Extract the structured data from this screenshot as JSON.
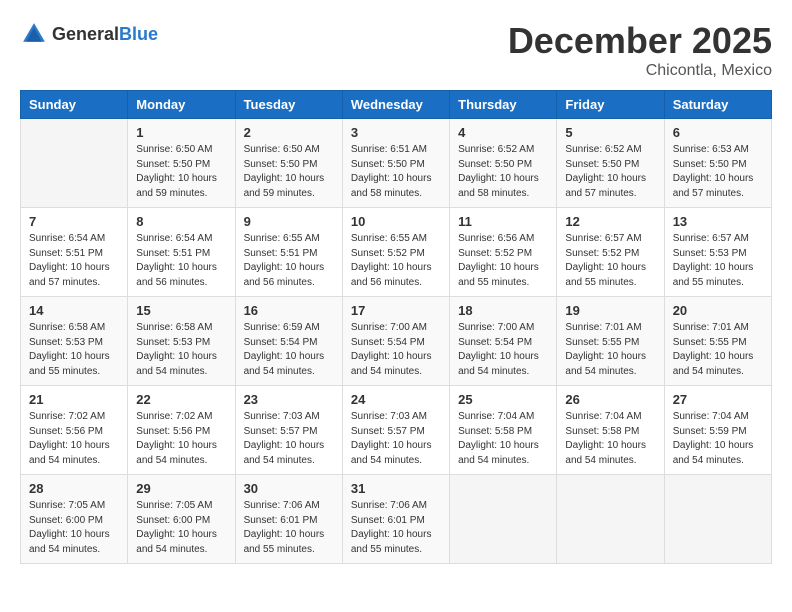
{
  "header": {
    "logo_general": "General",
    "logo_blue": "Blue",
    "month_year": "December 2025",
    "location": "Chicontla, Mexico"
  },
  "weekdays": [
    "Sunday",
    "Monday",
    "Tuesday",
    "Wednesday",
    "Thursday",
    "Friday",
    "Saturday"
  ],
  "weeks": [
    [
      {
        "day": "",
        "info": ""
      },
      {
        "day": "1",
        "info": "Sunrise: 6:50 AM\nSunset: 5:50 PM\nDaylight: 10 hours\nand 59 minutes."
      },
      {
        "day": "2",
        "info": "Sunrise: 6:50 AM\nSunset: 5:50 PM\nDaylight: 10 hours\nand 59 minutes."
      },
      {
        "day": "3",
        "info": "Sunrise: 6:51 AM\nSunset: 5:50 PM\nDaylight: 10 hours\nand 58 minutes."
      },
      {
        "day": "4",
        "info": "Sunrise: 6:52 AM\nSunset: 5:50 PM\nDaylight: 10 hours\nand 58 minutes."
      },
      {
        "day": "5",
        "info": "Sunrise: 6:52 AM\nSunset: 5:50 PM\nDaylight: 10 hours\nand 57 minutes."
      },
      {
        "day": "6",
        "info": "Sunrise: 6:53 AM\nSunset: 5:50 PM\nDaylight: 10 hours\nand 57 minutes."
      }
    ],
    [
      {
        "day": "7",
        "info": "Sunrise: 6:54 AM\nSunset: 5:51 PM\nDaylight: 10 hours\nand 57 minutes."
      },
      {
        "day": "8",
        "info": "Sunrise: 6:54 AM\nSunset: 5:51 PM\nDaylight: 10 hours\nand 56 minutes."
      },
      {
        "day": "9",
        "info": "Sunrise: 6:55 AM\nSunset: 5:51 PM\nDaylight: 10 hours\nand 56 minutes."
      },
      {
        "day": "10",
        "info": "Sunrise: 6:55 AM\nSunset: 5:52 PM\nDaylight: 10 hours\nand 56 minutes."
      },
      {
        "day": "11",
        "info": "Sunrise: 6:56 AM\nSunset: 5:52 PM\nDaylight: 10 hours\nand 55 minutes."
      },
      {
        "day": "12",
        "info": "Sunrise: 6:57 AM\nSunset: 5:52 PM\nDaylight: 10 hours\nand 55 minutes."
      },
      {
        "day": "13",
        "info": "Sunrise: 6:57 AM\nSunset: 5:53 PM\nDaylight: 10 hours\nand 55 minutes."
      }
    ],
    [
      {
        "day": "14",
        "info": "Sunrise: 6:58 AM\nSunset: 5:53 PM\nDaylight: 10 hours\nand 55 minutes."
      },
      {
        "day": "15",
        "info": "Sunrise: 6:58 AM\nSunset: 5:53 PM\nDaylight: 10 hours\nand 54 minutes."
      },
      {
        "day": "16",
        "info": "Sunrise: 6:59 AM\nSunset: 5:54 PM\nDaylight: 10 hours\nand 54 minutes."
      },
      {
        "day": "17",
        "info": "Sunrise: 7:00 AM\nSunset: 5:54 PM\nDaylight: 10 hours\nand 54 minutes."
      },
      {
        "day": "18",
        "info": "Sunrise: 7:00 AM\nSunset: 5:54 PM\nDaylight: 10 hours\nand 54 minutes."
      },
      {
        "day": "19",
        "info": "Sunrise: 7:01 AM\nSunset: 5:55 PM\nDaylight: 10 hours\nand 54 minutes."
      },
      {
        "day": "20",
        "info": "Sunrise: 7:01 AM\nSunset: 5:55 PM\nDaylight: 10 hours\nand 54 minutes."
      }
    ],
    [
      {
        "day": "21",
        "info": "Sunrise: 7:02 AM\nSunset: 5:56 PM\nDaylight: 10 hours\nand 54 minutes."
      },
      {
        "day": "22",
        "info": "Sunrise: 7:02 AM\nSunset: 5:56 PM\nDaylight: 10 hours\nand 54 minutes."
      },
      {
        "day": "23",
        "info": "Sunrise: 7:03 AM\nSunset: 5:57 PM\nDaylight: 10 hours\nand 54 minutes."
      },
      {
        "day": "24",
        "info": "Sunrise: 7:03 AM\nSunset: 5:57 PM\nDaylight: 10 hours\nand 54 minutes."
      },
      {
        "day": "25",
        "info": "Sunrise: 7:04 AM\nSunset: 5:58 PM\nDaylight: 10 hours\nand 54 minutes."
      },
      {
        "day": "26",
        "info": "Sunrise: 7:04 AM\nSunset: 5:58 PM\nDaylight: 10 hours\nand 54 minutes."
      },
      {
        "day": "27",
        "info": "Sunrise: 7:04 AM\nSunset: 5:59 PM\nDaylight: 10 hours\nand 54 minutes."
      }
    ],
    [
      {
        "day": "28",
        "info": "Sunrise: 7:05 AM\nSunset: 6:00 PM\nDaylight: 10 hours\nand 54 minutes."
      },
      {
        "day": "29",
        "info": "Sunrise: 7:05 AM\nSunset: 6:00 PM\nDaylight: 10 hours\nand 54 minutes."
      },
      {
        "day": "30",
        "info": "Sunrise: 7:06 AM\nSunset: 6:01 PM\nDaylight: 10 hours\nand 55 minutes."
      },
      {
        "day": "31",
        "info": "Sunrise: 7:06 AM\nSunset: 6:01 PM\nDaylight: 10 hours\nand 55 minutes."
      },
      {
        "day": "",
        "info": ""
      },
      {
        "day": "",
        "info": ""
      },
      {
        "day": "",
        "info": ""
      }
    ]
  ]
}
